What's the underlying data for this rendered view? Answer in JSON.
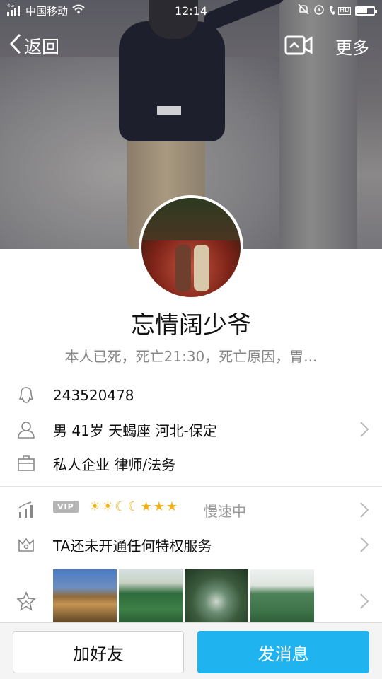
{
  "status_bar": {
    "carrier": "中国移动",
    "time": "12:14",
    "network_badge": "4G",
    "hd_badge": "HD"
  },
  "nav": {
    "back_label": "返回",
    "more_label": "更多"
  },
  "profile": {
    "nickname": "忘情阔少爷",
    "signature": "本人已死，死亡21:30，死亡原因，胃..."
  },
  "info": {
    "qq_number": "243520478",
    "basic": "男  41岁  天蝎座  河北-保定",
    "occupation": "私人企业 律师/法务"
  },
  "vip": {
    "badge": "VIP",
    "level_icons": [
      "sun",
      "sun",
      "moon",
      "moon",
      "star",
      "star",
      "star"
    ],
    "speed_status": "慢速中"
  },
  "privilege": {
    "text": "TA还未开通任何特权服务"
  },
  "photos": [
    {
      "name": "pagoda"
    },
    {
      "name": "lotus-pond"
    },
    {
      "name": "stone-bridge"
    },
    {
      "name": "lotus-field"
    }
  ],
  "actions": {
    "add_friend": "加好友",
    "send_message": "发消息"
  },
  "colors": {
    "accent": "#1fb3f0",
    "secondary_text": "#888888",
    "level_gold": "#f3b21b"
  }
}
